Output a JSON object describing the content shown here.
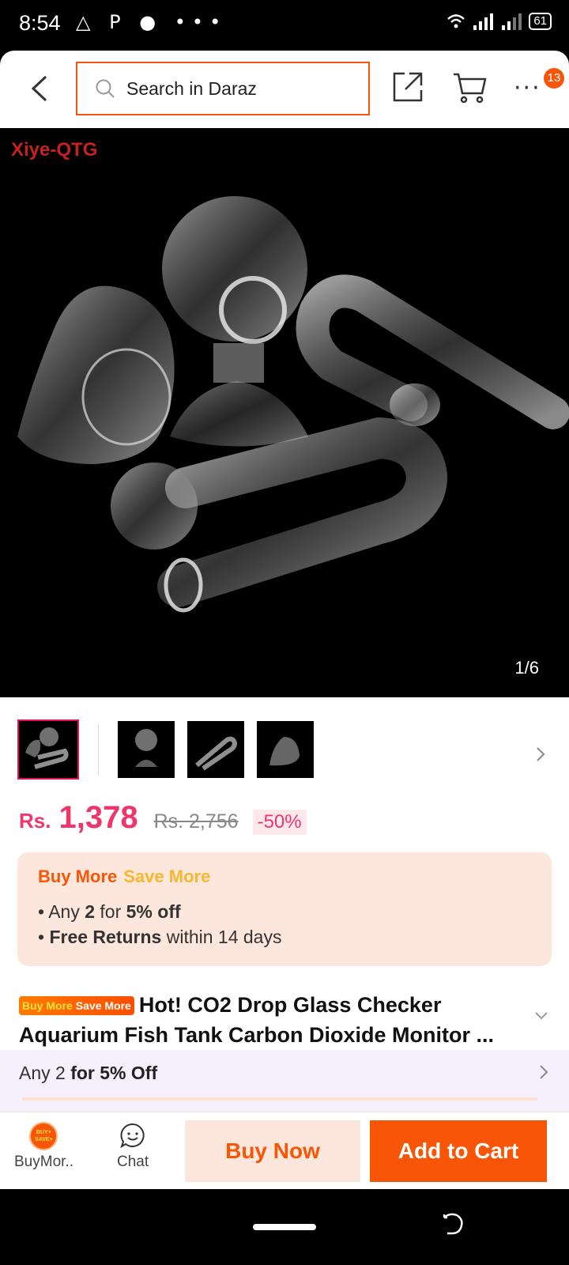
{
  "status_bar": {
    "time": "8:54",
    "left_icons": "△ P ● •••",
    "battery": "61"
  },
  "header": {
    "search_placeholder": "Search in Daraz",
    "cart_badge": "13"
  },
  "gallery": {
    "watermark": "Xiye-QTG",
    "counter": "1/6"
  },
  "price": {
    "currency": "Rs.",
    "current": "1,378",
    "original": "Rs. 2,756",
    "discount": "-50%"
  },
  "promo": {
    "buy_more": "Buy More",
    "save_more": "Save More",
    "line1_pre": "Any ",
    "line1_num": "2",
    "line1_mid": " for ",
    "line1_bold": "5% off",
    "line2_bold": "Free Returns",
    "line2_rest": " within 14 days"
  },
  "title": {
    "badge_buy": "Buy More",
    "badge_save": "Save More",
    "line1": "Hot!  CO2 Drop Glass Checker",
    "line2": "Aquarium Fish Tank Carbon Dioxide Monitor ..."
  },
  "offer": {
    "pre": "Any 2 ",
    "bold": "for 5% Off"
  },
  "action_bar": {
    "buymore_label": "BuyMor..",
    "buymore_icon_text": "BUY+ SAVE+",
    "chat_label": "Chat",
    "buy_now": "Buy Now",
    "add_to_cart": "Add to Cart"
  },
  "colors": {
    "brand": "#f85606",
    "price": "#f0356b",
    "promo_bg": "#fde7dc"
  }
}
